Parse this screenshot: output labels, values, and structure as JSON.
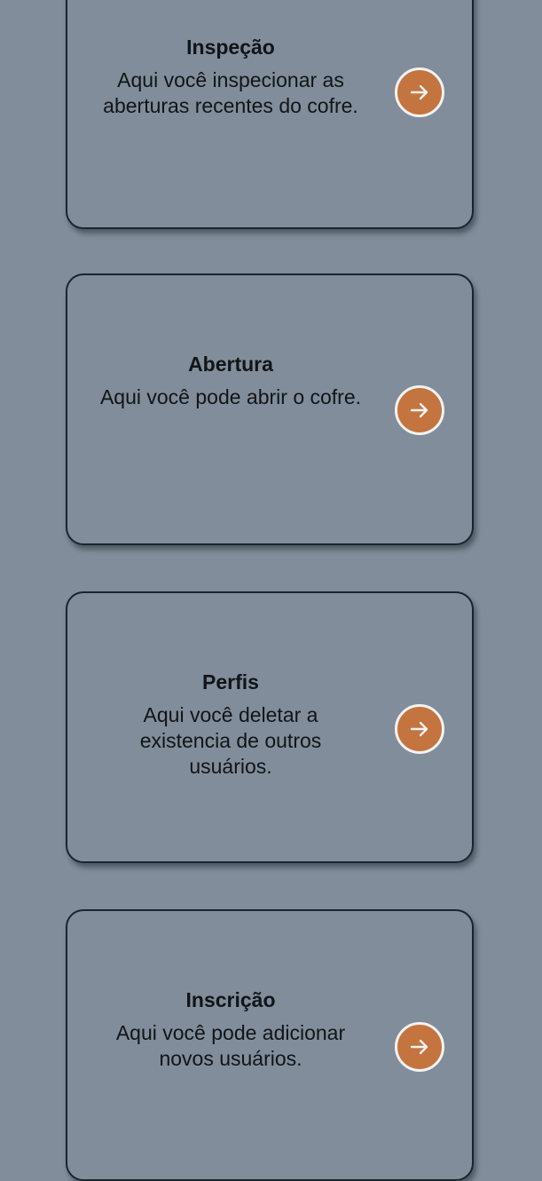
{
  "cards": [
    {
      "title": "Inspeção",
      "description": "Aqui você inspecionar as aberturas recentes do cofre.",
      "action_icon": "arrow-right-icon"
    },
    {
      "title": "Abertura",
      "description": "Aqui você pode abrir o cofre.",
      "action_icon": "arrow-right-icon"
    },
    {
      "title": "Perfis",
      "description": "Aqui você deletar a existencia de outros usuários.",
      "action_icon": "arrow-right-icon"
    },
    {
      "title": "Inscrição",
      "description": "Aqui você pode adicionar novos usuários.",
      "action_icon": "arrow-right-icon"
    }
  ],
  "colors": {
    "background": "#818d9a",
    "card_border": "#1b2530",
    "button_fill": "#c4743f",
    "button_ring": "#f2f2f2",
    "text": "#111418"
  }
}
